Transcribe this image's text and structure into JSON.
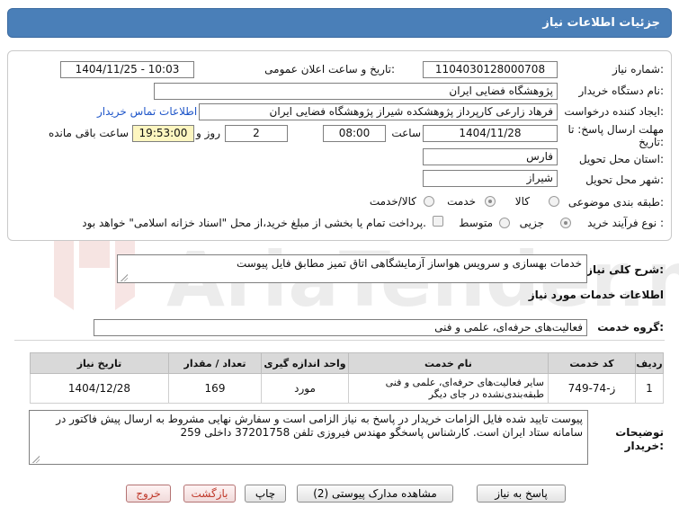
{
  "header": {
    "title": "جزئیات اطلاعات نیاز"
  },
  "watermark": {
    "text": "AriaTender.neT"
  },
  "form": {
    "need_number": {
      "label": "شماره نیاز:",
      "value": "1104030128000708"
    },
    "announce": {
      "label": "تاریخ و ساعت اعلان عمومی:",
      "value": "1404/11/25 - 10:03"
    },
    "buyer_org": {
      "label": "نام دستگاه خریدار:",
      "value": "پژوهشگاه فضایی ایران"
    },
    "requester": {
      "label": "ایجاد کننده درخواست:",
      "value": "فرهاد زارعی کارپرداز پژوهشکده شیراز پژوهشگاه فضایی ایران"
    },
    "contact_link": "اطلاعات تماس خریدار",
    "deadline": {
      "label_line1": "مهلت ارسال پاسخ: تا",
      "label_line2": "تاریخ:",
      "date": "1404/11/28",
      "time_label": "ساعت",
      "time": "08:00",
      "days": "2",
      "days_label": "روز و",
      "remaining": "19:53:00",
      "remaining_label": "ساعت باقی مانده"
    },
    "province": {
      "label": "استان محل تحویل:",
      "value": "فارس"
    },
    "city": {
      "label": "شهر محل تحویل:",
      "value": "شیراز"
    },
    "category": {
      "label": "طبقه بندی موضوعی:",
      "options": [
        "کالا",
        "خدمت",
        "کالا/خدمت"
      ],
      "selected": "خدمت"
    },
    "purchase_type": {
      "label": "نوع فرآیند خرید :",
      "options": [
        "جزیی",
        "متوسط"
      ],
      "selected": "جزیی",
      "payment_note": "پرداخت تمام یا بخشی از مبلغ خرید،از محل \"اسناد خزانه اسلامی\" خواهد بود."
    }
  },
  "summary": {
    "label": "شرح کلی نیاز:",
    "value": "خدمات بهسازی و سرویس هواساز آزمایشگاهی اتاق تمیز مطابق فایل پیوست"
  },
  "services_heading": "اطلاعات خدمات مورد نیاز",
  "service_group": {
    "label": "گروه خدمت:",
    "value": "فعالیت‌های حرفه‌ای، علمی و فنی"
  },
  "table": {
    "headers": [
      "ردیف",
      "کد خدمت",
      "نام خدمت",
      "واحد اندازه گیری",
      "تعداد / مقدار",
      "تاریخ نیاز"
    ],
    "rows": [
      [
        "1",
        "ز-74-749",
        "سایر فعالیت‌های حرفه‌ای، علمی و فنی طبقه‌بندی‌نشده در جای دیگر",
        "مورد",
        "169",
        "1404/12/28"
      ]
    ]
  },
  "buyer_notes": {
    "label_line1": "توضیحات",
    "label_line2": "خریدار:",
    "value": "پیوست تایید شده فایل الزامات خریدار در پاسخ به نیاز الزامی است و سفارش نهایی مشروط به ارسال پیش فاکتور در سامانه ستاد ایران است. کارشناس پاسخگو مهندس فیروزی تلفن 37201758 داخلی 259"
  },
  "buttons": {
    "reply": "پاسخ به نیاز",
    "docs": "مشاهده مدارک پیوستی (2)",
    "print": "چاپ",
    "back": "بازگشت",
    "exit": "خروج"
  }
}
